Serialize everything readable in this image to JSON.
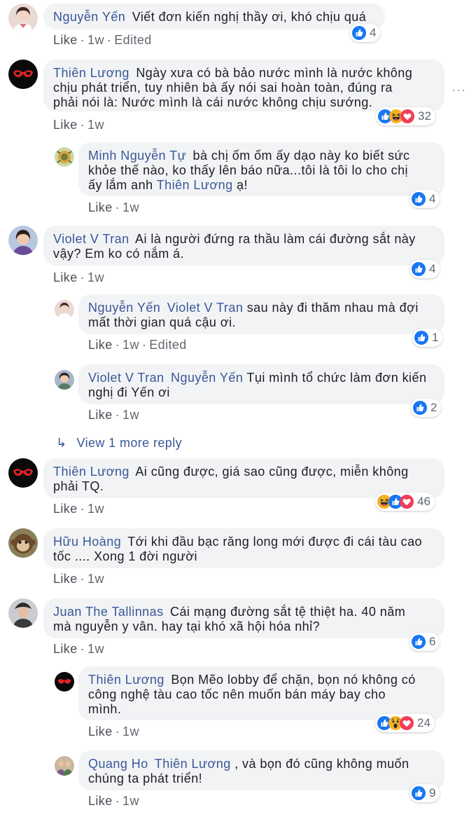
{
  "ui": {
    "like_label": "Like",
    "dot": "·",
    "more_options": "···",
    "view_more_replies": "View 1 more reply"
  },
  "colors": {
    "author": "#385898",
    "bubble": "#f2f3f5",
    "like_blue": "#1877f2",
    "love_red": "#f33e58",
    "haha_yellow": "#f7b125"
  },
  "comments": [
    {
      "author": "Nguyễn Yến",
      "text": "Viết đơn kiến nghị thầy ơi, khó chịu quá",
      "time": "1w",
      "edited": "Edited",
      "reactions": {
        "types": [
          "like"
        ],
        "count": "4"
      },
      "avatar_icon": "woman-avatar-icon"
    },
    {
      "author": "Thiên Lương",
      "text_lines": [
        "Ngày xưa có bà bảo nước mình là nước không",
        "chịu phát triển, tuy nhiên bà ấy nói sai hoàn toàn, đúng ra",
        "phải nói là: Nước mình là cái nước không chịu sướng."
      ],
      "time": "1w",
      "reactions": {
        "types": [
          "like",
          "haha",
          "love"
        ],
        "count": "32"
      },
      "avatar_icon": "red-glasses-avatar-icon",
      "replies": [
        {
          "author": "Minh Nguyễn Tự",
          "text_lines": [
            "bà chị ốm ốm ấy dạo này ko biết sức",
            "khỏe thế nào, ko thấy lên báo nữa...tôi là tôi lo cho chị",
            "ấy lắm anh"
          ],
          "mention": "Thiên Lương",
          "text_after": "ạ!",
          "time": "1w",
          "reactions": {
            "types": [
              "like"
            ],
            "count": "4"
          }
        }
      ]
    },
    {
      "author": "Violet V Tran",
      "text_lines": [
        "Ai là người đứng ra thầu làm cái đường sắt này",
        "vậy? Em ko có nắm á."
      ],
      "time": "1w",
      "reactions": {
        "types": [
          "like"
        ],
        "count": "4"
      },
      "replies": [
        {
          "author": "Nguyễn Yến",
          "mention": "Violet V Tran",
          "text_lines": [
            "sau này đi thăm nhau mà đợi",
            "mất thời gian quá cậu ơi."
          ],
          "time": "1w",
          "edited": "Edited",
          "reactions": {
            "types": [
              "like"
            ],
            "count": "1"
          }
        },
        {
          "author": "Violet V Tran",
          "mention": "Nguyễn Yến",
          "text_lines": [
            "Tụi mình tổ chức làm đơn kiến",
            "nghị đi Yến ơi"
          ],
          "time": "1w",
          "reactions": {
            "types": [
              "like"
            ],
            "count": "2"
          }
        }
      ]
    },
    {
      "author": "Thiên Lương",
      "text_lines": [
        "Ai cũng được, giá sao cũng được, miễn không",
        "phải TQ."
      ],
      "time": "1w",
      "reactions": {
        "types": [
          "haha",
          "like",
          "love"
        ],
        "count": "46"
      }
    },
    {
      "author": "Hữu Hoàng",
      "text_lines": [
        "Tới khi đầu bạc răng long mới được đi cái tàu cao",
        "tốc .... Xong 1 đời người"
      ],
      "time": "1w"
    },
    {
      "author": "Juan The Tallinnas",
      "text_lines": [
        "Cái mạng đường sắt tệ thiệt ha. 40 năm",
        "mà nguyễn y vân. hay tại khó xã hội hóa nhỉ?"
      ],
      "time": "1w",
      "reactions": {
        "types": [
          "like"
        ],
        "count": "6"
      },
      "replies": [
        {
          "author": "Thiên Lương",
          "text_lines": [
            "Bọn Mẽo lobby để chặn, bọn nó không có",
            "công nghệ tàu cao tốc nên muốn bán máy bay cho",
            "mình."
          ],
          "time": "1w",
          "reactions": {
            "types": [
              "like",
              "wow",
              "love"
            ],
            "count": "24"
          }
        },
        {
          "author": "Quang Ho",
          "mention": "Thiên Lương",
          "text_lines": [
            ", và bọn đó cũng không muốn",
            "chúng ta phát triển!"
          ],
          "time": "1w",
          "reactions": {
            "types": [
              "like"
            ],
            "count": "9"
          }
        }
      ]
    }
  ]
}
